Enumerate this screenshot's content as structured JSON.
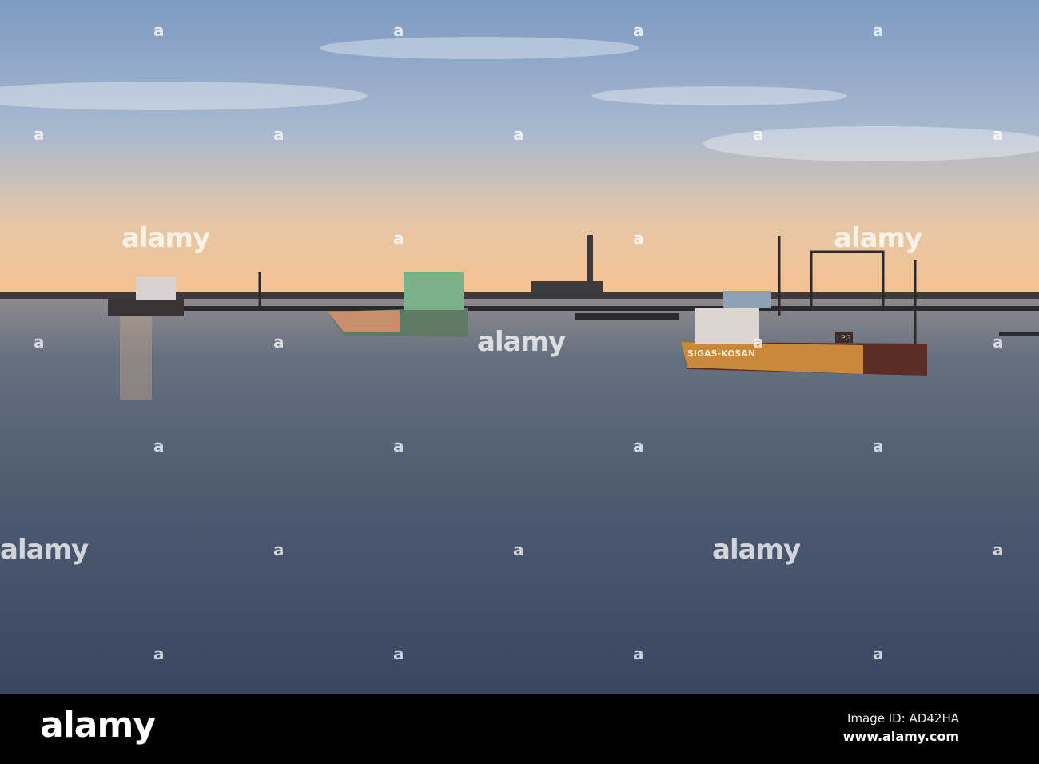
{
  "watermark": {
    "brand": "alamy",
    "mark": "a"
  },
  "ship_texts": {
    "hull_name": "SIGAS-KOSAN",
    "funnel_sign": "LPG"
  },
  "footer": {
    "logo": "alamy",
    "image_id": "Image ID: AD42HA",
    "url": "www.alamy.com"
  },
  "colors": {
    "sky_top": "#7f9cc4",
    "horizon": "#f2c79a",
    "water": "#4b5a72",
    "footer": "#000000"
  }
}
